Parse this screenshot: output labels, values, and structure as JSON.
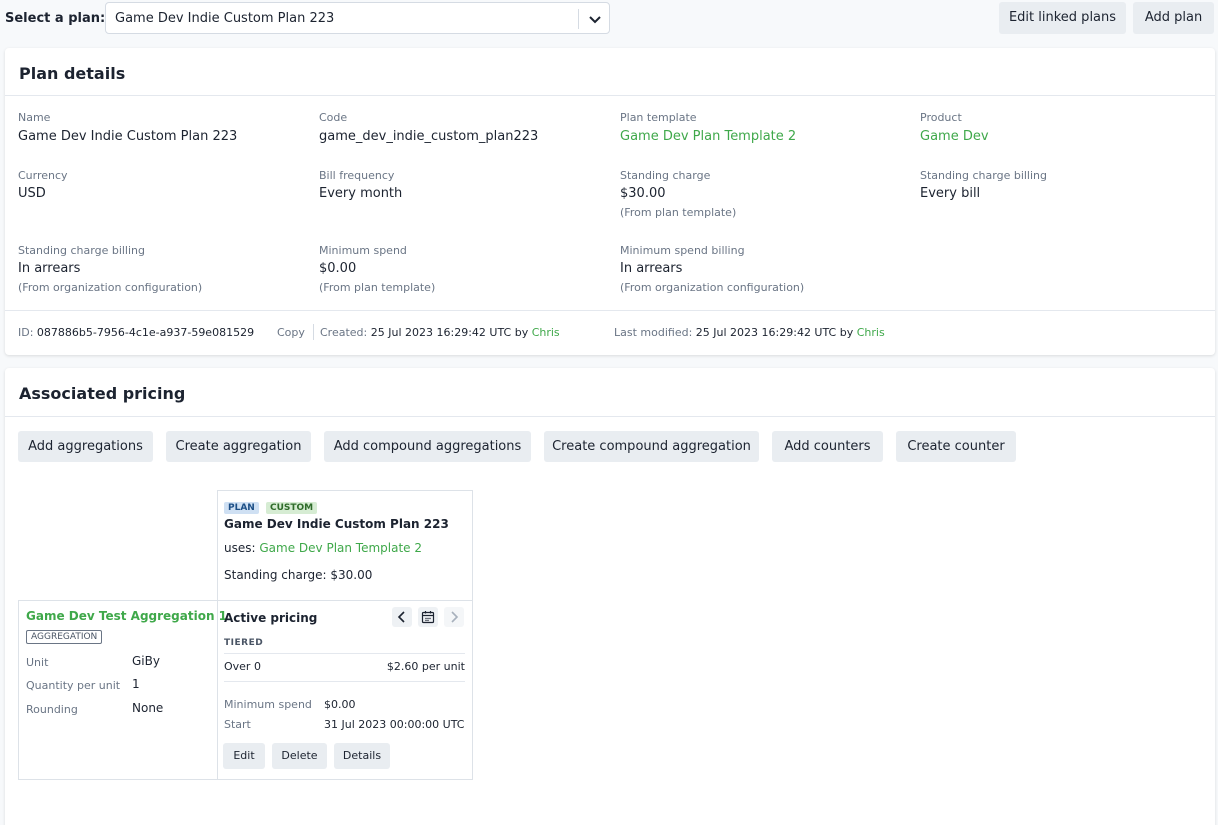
{
  "topbar": {
    "select_label": "Select a plan:",
    "selected_plan": "Game Dev Indie Custom Plan 223",
    "edit_linked_plans": "Edit linked plans",
    "add_plan": "Add plan"
  },
  "plan_details": {
    "title": "Plan details",
    "fields": {
      "name": {
        "label": "Name",
        "value": "Game Dev Indie Custom Plan 223"
      },
      "code": {
        "label": "Code",
        "value": "game_dev_indie_custom_plan223"
      },
      "plan_template": {
        "label": "Plan template",
        "value": "Game Dev Plan Template 2"
      },
      "product": {
        "label": "Product",
        "value": "Game Dev"
      },
      "currency": {
        "label": "Currency",
        "value": "USD"
      },
      "bill_frequency": {
        "label": "Bill frequency",
        "value": "Every month"
      },
      "standing_charge": {
        "label": "Standing charge",
        "value": "$30.00",
        "note": "(From plan template)"
      },
      "standing_charge_billing_1": {
        "label": "Standing charge billing",
        "value": "Every bill"
      },
      "standing_charge_billing_2": {
        "label": "Standing charge billing",
        "value": "In arrears",
        "note": "(From organization configuration)"
      },
      "minimum_spend": {
        "label": "Minimum spend",
        "value": "$0.00",
        "note": "(From plan template)"
      },
      "minimum_spend_billing": {
        "label": "Minimum spend billing",
        "value": "In arrears",
        "note": "(From organization configuration)"
      }
    },
    "meta": {
      "id_label": "ID:",
      "id_value": "087886b5-7956-4c1e-a937-59e081529",
      "copy": "Copy",
      "created_label": "Created:",
      "created_value": "25 Jul 2023 16:29:42 UTC by",
      "created_by": "Chris",
      "modified_label": "Last modified:",
      "modified_value": "25 Jul 2023 16:29:42 UTC by",
      "modified_by": "Chris"
    }
  },
  "associated_pricing": {
    "title": "Associated pricing",
    "buttons": [
      "Add aggregations",
      "Create aggregation",
      "Add compound aggregations",
      "Create compound aggregation",
      "Add counters",
      "Create counter"
    ],
    "plan_card": {
      "tag_plan": "PLAN",
      "tag_custom": "CUSTOM",
      "name": "Game Dev Indie Custom Plan 223",
      "uses_label": "uses:",
      "uses_value": "Game Dev Plan Template 2",
      "standing_charge": "Standing charge: $30.00"
    },
    "aggregation": {
      "name": "Game Dev Test Aggregation 1",
      "tag": "AGGREGATION",
      "unit_label": "Unit",
      "unit_value": "GiBy",
      "qpu_label": "Quantity per unit",
      "qpu_value": "1",
      "rounding_label": "Rounding",
      "rounding_value": "None"
    },
    "pricing": {
      "title": "Active pricing",
      "type": "TIERED",
      "tier_label": "Over 0",
      "tier_value": "$2.60 per unit",
      "min_spend_label": "Minimum spend",
      "min_spend_value": "$0.00",
      "start_label": "Start",
      "start_value": "31 Jul 2023 00:00:00 UTC",
      "edit": "Edit",
      "delete": "Delete",
      "details": "Details"
    }
  },
  "colors": {
    "accent_green": "#3fa84a",
    "tag_plan_bg": "#cfe0f3",
    "tag_custom_bg": "#d6ecd3"
  }
}
